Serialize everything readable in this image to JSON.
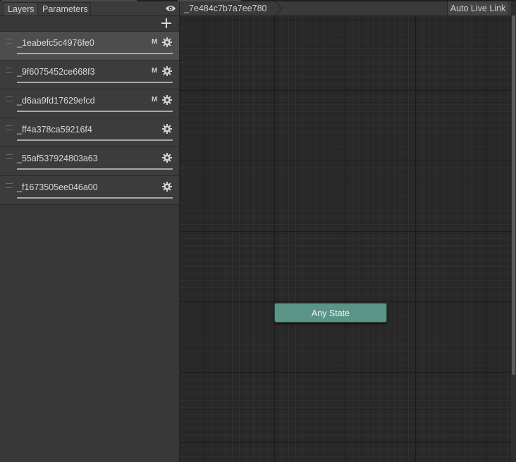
{
  "tabs": {
    "layers": "Layers",
    "parameters": "Parameters"
  },
  "icons": {
    "visibility": "eye-icon",
    "add_layer": "plus-icon",
    "settings": "gear-icon",
    "drag": "drag-handle-icon"
  },
  "layers": [
    {
      "name": "_1eabefc5c4976fe0",
      "badge": "M",
      "selected": true
    },
    {
      "name": "_9f6075452ce668f3",
      "badge": "M",
      "selected": false
    },
    {
      "name": "_d6aa9fd17629efcd",
      "badge": "M",
      "selected": false
    },
    {
      "name": "_ff4a378ca59216f4",
      "badge": "",
      "selected": false
    },
    {
      "name": "_55af537924803a63",
      "badge": "",
      "selected": false
    },
    {
      "name": "_f1673505ee046a00",
      "badge": "",
      "selected": false
    }
  ],
  "graph": {
    "breadcrumb": "_7e484c7b7a7ee780",
    "auto_live_link": "Auto Live Link",
    "any_state": "Any State"
  },
  "colors": {
    "any_state_fill": "#5a9587",
    "graph_background": "#282828",
    "panel_background": "#383838"
  }
}
